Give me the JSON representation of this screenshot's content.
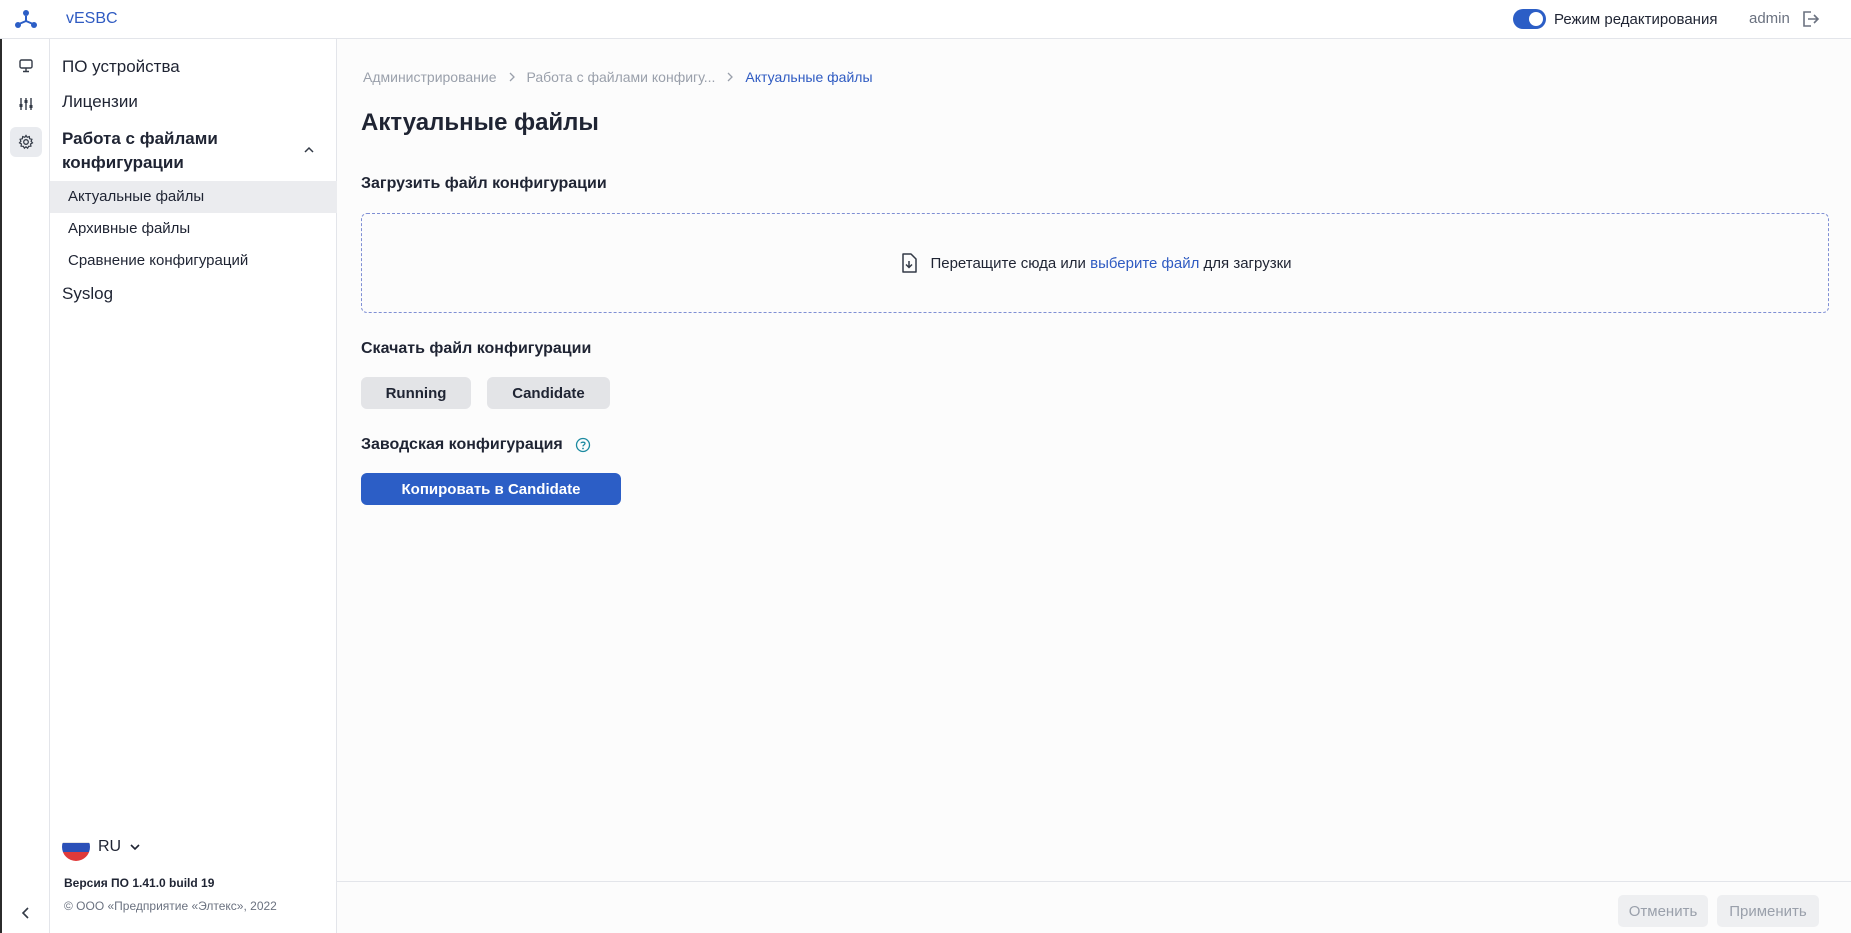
{
  "header": {
    "app_title": "vESBC",
    "edit_mode_label": "Режим редактирования",
    "edit_mode_on": true,
    "user": "admin"
  },
  "rail": {
    "items": [
      {
        "icon": "monitor-icon"
      },
      {
        "icon": "sliders-icon"
      },
      {
        "icon": "gear-icon",
        "active": true
      }
    ]
  },
  "sidebar": {
    "items": [
      {
        "label": "ПО устройства"
      },
      {
        "label": "Лицензии"
      }
    ],
    "group_label": "Работа с файлами конфигурации",
    "sub_items": [
      {
        "label": "Актуальные файлы",
        "active": true
      },
      {
        "label": "Архивные файлы"
      },
      {
        "label": "Сравнение конфигураций"
      }
    ],
    "syslog_label": "Syslog",
    "language": "RU",
    "version": "Версия ПО 1.41.0 build 19",
    "copyright": "© ООО «Предприятие «Элтекс», 2022"
  },
  "breadcrumb": [
    "Администрирование",
    "Работа с файлами конфигу...",
    "Актуальные файлы"
  ],
  "main": {
    "title": "Актуальные файлы",
    "upload_title": "Загрузить файл конфигурации",
    "drop_text_before": "Перетащите сюда или ",
    "drop_link": "выберите файл",
    "drop_text_after": " для загрузки",
    "download_title": "Скачать файл конфигурации",
    "running_label": "Running",
    "candidate_label": "Candidate",
    "factory_title": "Заводская конфигурация",
    "copy_button": "Копировать в Candidate"
  },
  "footer": {
    "cancel_label": "Отменить",
    "apply_label": "Применить"
  },
  "colors": {
    "accent": "#2c5ec6",
    "link": "#2f5bc2"
  }
}
